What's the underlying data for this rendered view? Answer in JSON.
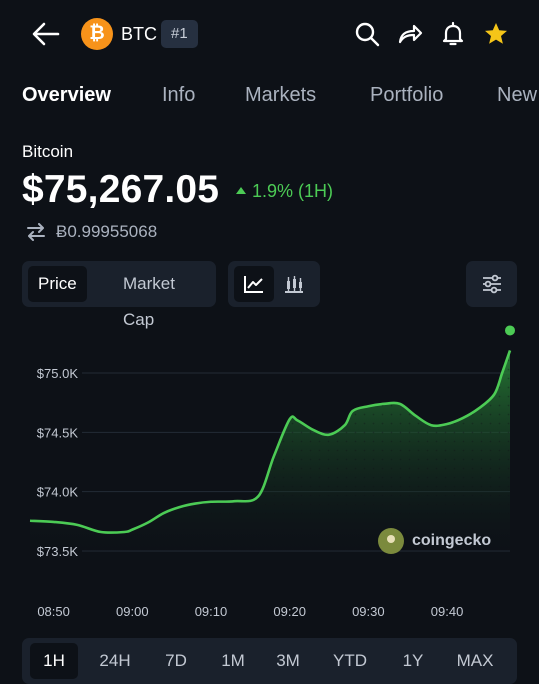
{
  "header": {
    "coin_symbol": "BTC",
    "rank": "#1",
    "icons": [
      "back-arrow-icon",
      "bitcoin-logo-icon",
      "search-icon",
      "share-icon",
      "bell-icon",
      "star-icon"
    ]
  },
  "tabs": [
    "Overview",
    "Info",
    "Markets",
    "Portfolio",
    "New"
  ],
  "coin": {
    "name": "Bitcoin",
    "price": "$75,267.05",
    "change": "1.9% (1H)",
    "btc_value": "Ƀ0.99955068"
  },
  "controls": {
    "metric_options": [
      "Price",
      "Market Cap"
    ],
    "selected_metric": "Price",
    "chart_type_icons": [
      "line-chart-icon",
      "candlestick-icon"
    ],
    "filter_icon": "sliders-icon"
  },
  "chart_data": {
    "type": "area",
    "x": [
      "08:47",
      "08:50",
      "08:53",
      "08:56",
      "08:59",
      "09:00",
      "09:02",
      "09:04",
      "09:06",
      "09:08",
      "09:10",
      "09:13",
      "09:16",
      "09:18",
      "09:20",
      "09:21",
      "09:23",
      "09:25",
      "09:27",
      "09:28",
      "09:30",
      "09:32",
      "09:34",
      "09:36",
      "09:38",
      "09:40",
      "09:42",
      "09:44",
      "09:46",
      "09:47",
      "09:48"
    ],
    "y": [
      73755,
      73745,
      73720,
      73660,
      73660,
      73680,
      73740,
      73820,
      73870,
      73900,
      73915,
      73920,
      73960,
      74300,
      74610,
      74600,
      74520,
      74480,
      74560,
      74680,
      74720,
      74740,
      74740,
      74640,
      74560,
      74570,
      74620,
      74700,
      74820,
      75000,
      75190
    ],
    "xticks": [
      "08:50",
      "09:00",
      "09:10",
      "09:20",
      "09:30",
      "09:40"
    ],
    "yticks": [
      "$75.0K",
      "$74.5K",
      "$74.0K",
      "$73.5K"
    ],
    "ytick_values": [
      75000,
      74500,
      74000,
      73500
    ],
    "ylim": [
      73500,
      75000
    ],
    "grid": true,
    "watermark": "coingecko",
    "colors": {
      "line": "#4ccb55",
      "fill": "#1f6b2c",
      "grid": "#232b36"
    }
  },
  "ranges": [
    "1H",
    "24H",
    "7D",
    "1M",
    "3M",
    "YTD",
    "1Y",
    "MAX"
  ],
  "selected_range": "1H",
  "colors": {
    "background": "#0d1117",
    "panel": "#1a212c",
    "positive": "#4ccb55",
    "bitcoin": "#f7931a",
    "star": "#f5c518"
  }
}
